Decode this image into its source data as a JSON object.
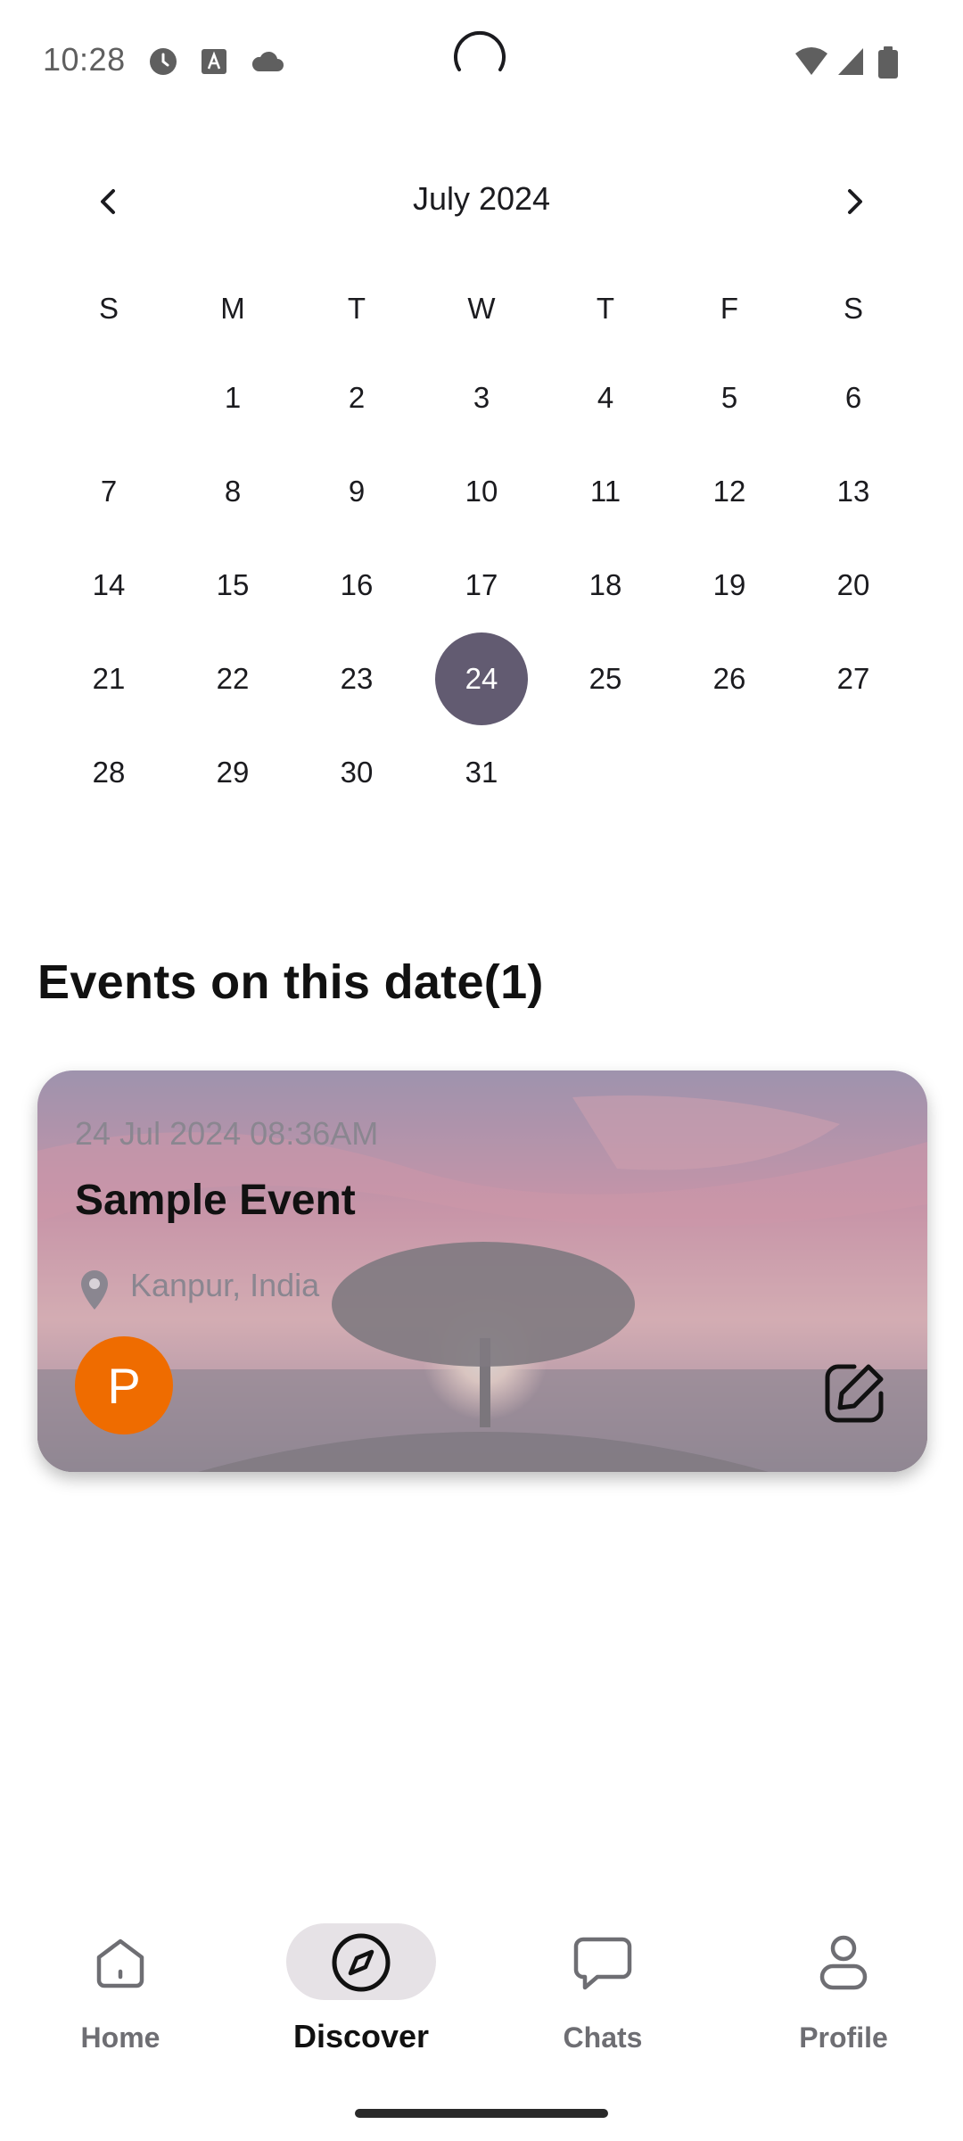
{
  "status_bar": {
    "time": "10:28",
    "icons": [
      "clock-icon",
      "text-a-icon",
      "cloud-icon",
      "wifi-icon",
      "signal-icon",
      "battery-icon"
    ]
  },
  "calendar": {
    "month_title": "July 2024",
    "prev_icon": "chevron-left-icon",
    "next_icon": "chevron-right-icon",
    "weekdays": [
      "S",
      "M",
      "T",
      "W",
      "T",
      "F",
      "S"
    ],
    "weeks": [
      [
        "",
        "1",
        "2",
        "3",
        "4",
        "5",
        "6"
      ],
      [
        "7",
        "8",
        "9",
        "10",
        "11",
        "12",
        "13"
      ],
      [
        "14",
        "15",
        "16",
        "17",
        "18",
        "19",
        "20"
      ],
      [
        "21",
        "22",
        "23",
        "24",
        "25",
        "26",
        "27"
      ],
      [
        "28",
        "29",
        "30",
        "31",
        "",
        "",
        ""
      ]
    ],
    "selected_day": "24",
    "selected_color": "#625b71"
  },
  "events": {
    "title": "Events on this date(1)",
    "items": [
      {
        "datetime": "24 Jul 2024 08:36AM",
        "name": "Sample Event",
        "location": "Kanpur, India",
        "avatar_letter": "P",
        "avatar_color": "#ef6c00",
        "edit_icon": "edit-icon",
        "location_icon": "location-pin-icon"
      }
    ]
  },
  "bottom_nav": {
    "items": [
      {
        "label": "Home",
        "icon": "home-icon",
        "active": false
      },
      {
        "label": "Discover",
        "icon": "compass-icon",
        "active": true
      },
      {
        "label": "Chats",
        "icon": "chat-bubble-icon",
        "active": false
      },
      {
        "label": "Profile",
        "icon": "person-icon",
        "active": false
      }
    ]
  }
}
